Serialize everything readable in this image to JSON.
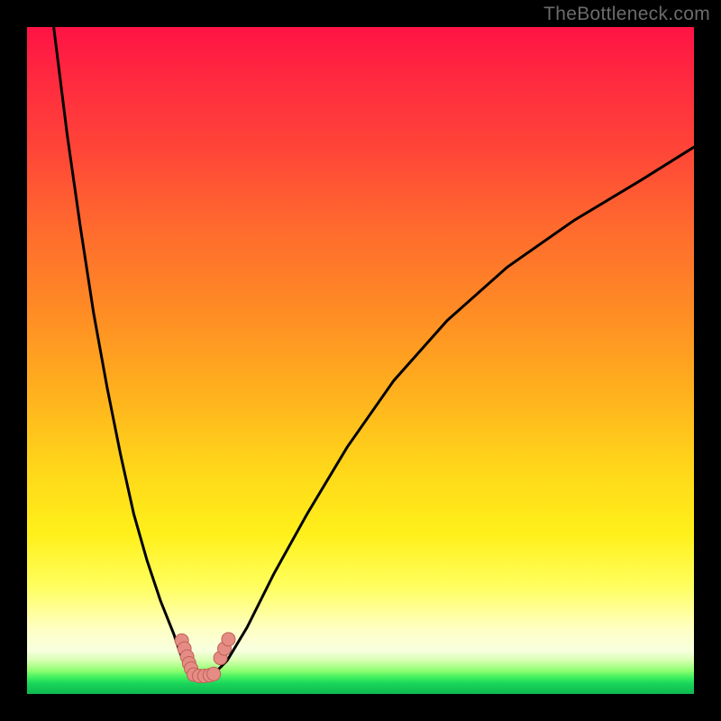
{
  "watermark": "TheBottleneck.com",
  "chart_data": {
    "type": "line",
    "title": "",
    "xlabel": "",
    "ylabel": "",
    "xlim": [
      0,
      100
    ],
    "ylim": [
      0,
      100
    ],
    "grid": false,
    "legend": false,
    "note": "Bottleneck-style V curve. Axes unlabeled; values estimated from pixel positions normalized to 0–100.",
    "series": [
      {
        "name": "left-branch",
        "x": [
          4,
          6,
          8,
          10,
          12,
          14,
          16,
          18,
          20,
          22,
          23,
          24,
          24.5
        ],
        "y": [
          100,
          84,
          70,
          57,
          46,
          36,
          27,
          20,
          14,
          9,
          6,
          4,
          3
        ]
      },
      {
        "name": "right-branch",
        "x": [
          28,
          30,
          33,
          37,
          42,
          48,
          55,
          63,
          72,
          82,
          92,
          100
        ],
        "y": [
          3,
          5,
          10,
          18,
          27,
          37,
          47,
          56,
          64,
          71,
          77,
          82
        ]
      },
      {
        "name": "valley-floor",
        "x": [
          24.5,
          25.5,
          27,
          28
        ],
        "y": [
          3,
          2.7,
          2.7,
          3
        ]
      }
    ],
    "markers": [
      {
        "name": "left-cluster",
        "points": [
          [
            23.2,
            8.0
          ],
          [
            23.6,
            6.8
          ],
          [
            24.0,
            5.6
          ],
          [
            24.3,
            4.6
          ],
          [
            24.6,
            3.8
          ]
        ]
      },
      {
        "name": "right-cluster",
        "points": [
          [
            29.0,
            5.4
          ],
          [
            29.6,
            6.8
          ],
          [
            30.2,
            8.2
          ]
        ]
      },
      {
        "name": "bottom-cluster",
        "points": [
          [
            25.0,
            2.9
          ],
          [
            25.8,
            2.7
          ],
          [
            26.6,
            2.7
          ],
          [
            27.4,
            2.8
          ],
          [
            28.0,
            3.0
          ]
        ]
      }
    ],
    "colors": {
      "curve": "#000000",
      "marker_fill": "#e58d85",
      "marker_stroke": "#c06058"
    }
  }
}
